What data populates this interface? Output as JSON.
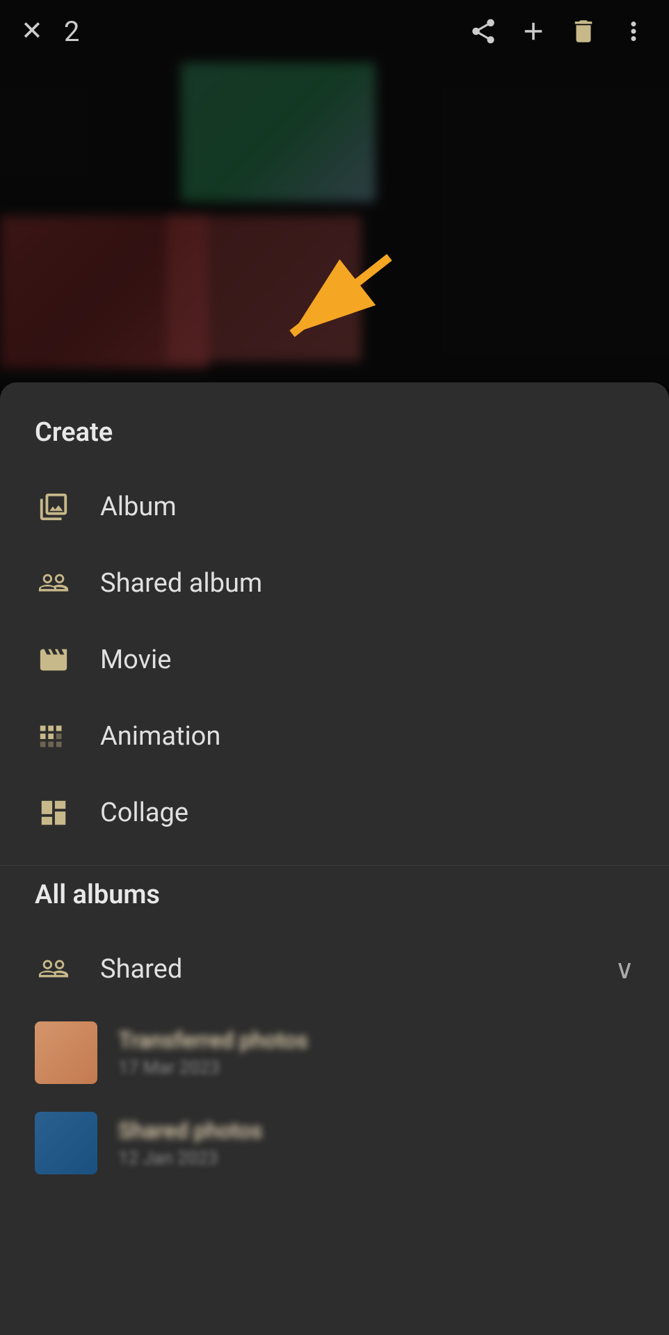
{
  "topbar": {
    "count": "2",
    "close_label": "×",
    "share_label": "share",
    "add_label": "+",
    "delete_label": "delete",
    "more_label": "⋮"
  },
  "menu": {
    "create_section": "Create",
    "items": [
      {
        "id": "album",
        "label": "Album",
        "icon": "album-icon"
      },
      {
        "id": "shared-album",
        "label": "Shared album",
        "icon": "shared-album-icon"
      },
      {
        "id": "movie",
        "label": "Movie",
        "icon": "movie-icon"
      },
      {
        "id": "animation",
        "label": "Animation",
        "icon": "animation-icon"
      },
      {
        "id": "collage",
        "label": "Collage",
        "icon": "collage-icon"
      }
    ],
    "all_albums_section": "All albums",
    "shared_label": "Shared",
    "albums": [
      {
        "id": "album-1",
        "name": "Transferred photos",
        "date": "17 Mar 2023",
        "thumb": "warm"
      },
      {
        "id": "album-2",
        "name": "Shared photos",
        "date": "12 Jan 2023",
        "thumb": "cool"
      }
    ]
  }
}
